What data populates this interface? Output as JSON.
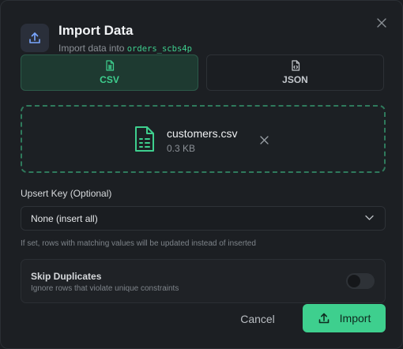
{
  "dialog": {
    "title": "Import Data",
    "subtitle_prefix": "Import data into",
    "table_name": "orders_scbs4p"
  },
  "icons": {
    "header": "upload-icon",
    "close": "close-icon",
    "csv_tab": "csv-file-icon",
    "json_tab": "json-file-icon",
    "file": "spreadsheet-file-icon",
    "remove": "close-icon",
    "select": "chevron-down-icon",
    "import": "upload-icon"
  },
  "tabs": [
    {
      "label": "CSV",
      "selected": true
    },
    {
      "label": "JSON",
      "selected": false
    }
  ],
  "file": {
    "name": "customers.csv",
    "size": "0.3 KB"
  },
  "upsert": {
    "label": "Upsert Key (Optional)",
    "value": "None (insert all)",
    "hint": "If set, rows with matching values will be updated instead of inserted"
  },
  "skip_duplicates": {
    "label": "Skip Duplicates",
    "description": "Ignore rows that violate unique constraints",
    "enabled": false
  },
  "actions": {
    "cancel": "Cancel",
    "import": "Import"
  },
  "colors": {
    "accent": "#3ecf8e",
    "background": "#1c1f23"
  }
}
